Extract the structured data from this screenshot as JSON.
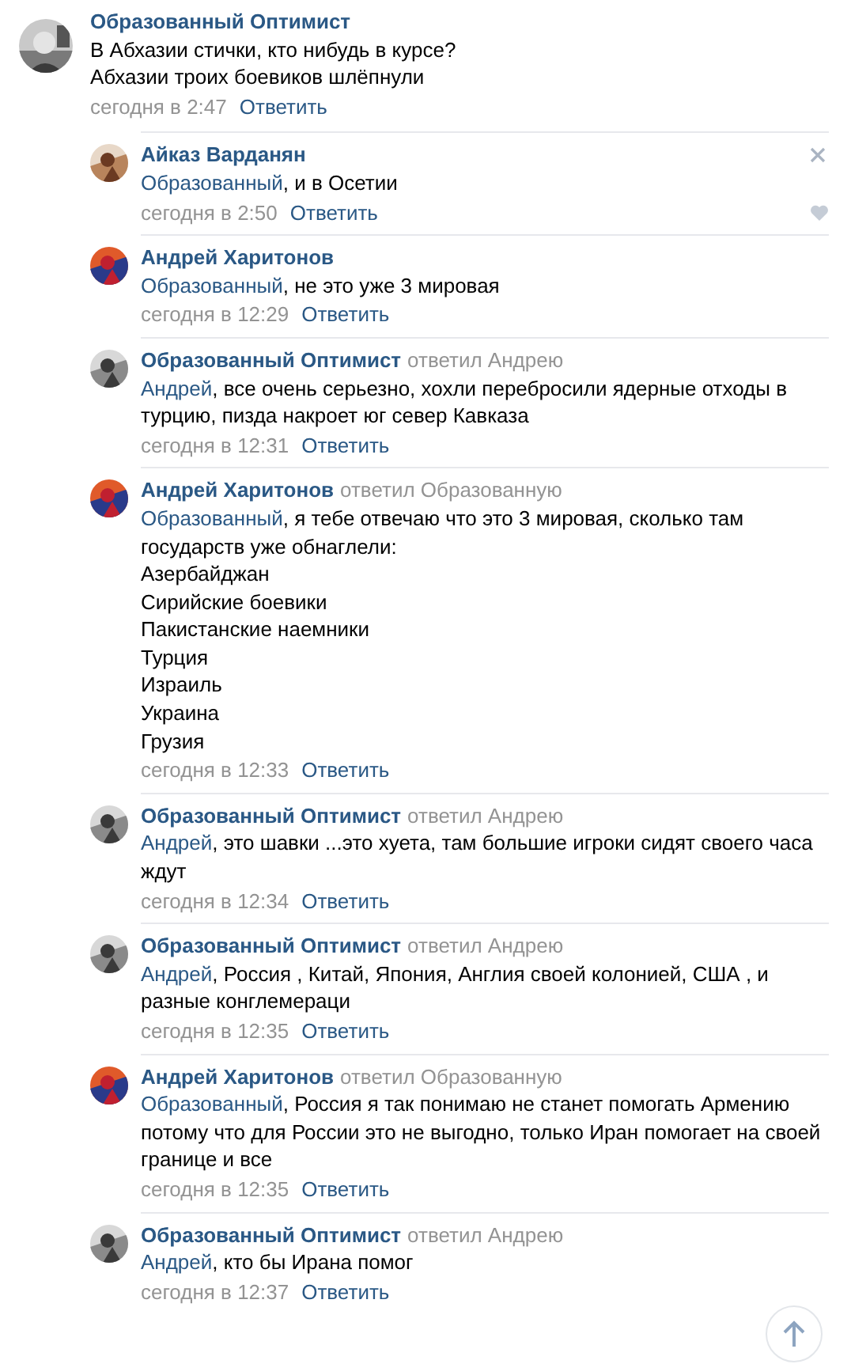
{
  "comment": {
    "author": "Образованный Оптимист",
    "lines": [
      "В Абхазии стички, кто нибудь в курсе?",
      "Абхазии троих боевиков шлёпнули"
    ],
    "time": "сегодня в 2:47",
    "reply_link": "Ответить"
  },
  "replies": [
    {
      "author": "Айказ Варданян",
      "addressee": "Образованный",
      "lines": [
        ", и в Осетии"
      ],
      "time": "сегодня в 2:50",
      "reply_link": "Ответить",
      "hovered": true
    },
    {
      "author": "Андрей Харитонов",
      "addressee": "Образованный",
      "lines": [
        ", не это уже 3 мировая"
      ],
      "time": "сегодня в 12:29",
      "reply_link": "Ответить",
      "hovered": false
    },
    {
      "author": "Образованный Оптимист",
      "replied_to": "ответил Андрею",
      "addressee": "Андрей",
      "lines": [
        ", все очень серьезно, хохли перебросили ядерные отходы в турцию, пизда накроет юг север Кавказа"
      ],
      "time": "сегодня в 12:31",
      "reply_link": "Ответить",
      "hovered": false
    },
    {
      "author": "Андрей Харитонов",
      "replied_to": "ответил Образованную",
      "addressee": "Образованный",
      "lines": [
        ", я тебе отвечаю что это 3 мировая, сколько там государств уже обнаглели:",
        "Азербайджан",
        "Сирийские боевики",
        "Пакистанские наемники",
        "Турция",
        "Израиль",
        "Украина",
        "Грузия"
      ],
      "time": "сегодня в 12:33",
      "reply_link": "Ответить",
      "hovered": false
    },
    {
      "author": "Образованный Оптимист",
      "replied_to": "ответил Андрею",
      "addressee": "Андрей",
      "lines": [
        ", это шавки ...это хуета, там большие игроки сидят своего часа ждут"
      ],
      "time": "сегодня в 12:34",
      "reply_link": "Ответить",
      "hovered": false
    },
    {
      "author": "Образованный Оптимист",
      "replied_to": "ответил Андрею",
      "addressee": "Андрей",
      "lines": [
        ", Россия , Китай, Япония, Англия своей колонией, США , и разные конглемераци"
      ],
      "time": "сегодня в 12:35",
      "reply_link": "Ответить",
      "hovered": false
    },
    {
      "author": "Андрей Харитонов",
      "replied_to": "ответил Образованную",
      "addressee": "Образованный",
      "lines": [
        ", Россия я так понимаю не станет помогать Армению потому что для России это не выгодно, только Иран помогает на своей границе и все"
      ],
      "time": "сегодня в 12:35",
      "reply_link": "Ответить",
      "hovered": false
    },
    {
      "author": "Образованный Оптимист",
      "replied_to": "ответил Андрею",
      "addressee": "Андрей",
      "lines": [
        ", кто бы Ирана помог"
      ],
      "time": "сегодня в 12:37",
      "reply_link": "Ответить",
      "hovered": false
    }
  ]
}
